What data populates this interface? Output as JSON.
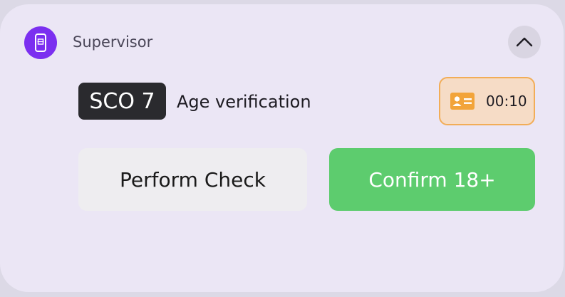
{
  "notification": {
    "app_name": "Supervisor",
    "app_icon": "phone-scan-icon",
    "collapse_icon": "chevron-up-icon",
    "accent_color": "#7b2ff0"
  },
  "task": {
    "station": "SCO 7",
    "title": "Age verification"
  },
  "timer": {
    "icon": "id-card-icon",
    "value": "00:10",
    "color": "#f2ad57"
  },
  "actions": {
    "perform_check_label": "Perform Check",
    "confirm_label": "Confirm 18+",
    "confirm_color": "#5dcc6e"
  }
}
